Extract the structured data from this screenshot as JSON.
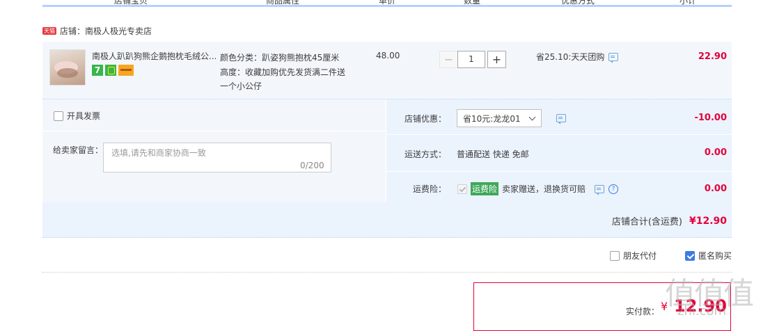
{
  "header": {
    "columns": [
      "店铺宝贝",
      "商品属性",
      "单价",
      "数量",
      "优惠方式",
      "小计"
    ]
  },
  "shop": {
    "badge": "天猫",
    "label": "店铺：南极人极光专卖店"
  },
  "item": {
    "title": "南极人趴趴狗熊企鹅抱枕毛绒公...",
    "service_icon_7": "7",
    "attr_line1": "颜色分类：趴姿狗熊抱枕45厘米",
    "attr_line2": "高度：收藏加购优先发货满二件送",
    "attr_line3": "一个小公仔",
    "price": "48.00",
    "qty_minus": "−",
    "qty_value": "1",
    "qty_plus": "+",
    "promo": "省25.10:天天团购",
    "subtotal": "22.90"
  },
  "options": {
    "invoice_label": "开具发票",
    "note_label": "给卖家留言：",
    "note_placeholder": "选填,请先和商家协商一致",
    "note_count": "0/200",
    "coupon_label": "店铺优惠：",
    "coupon_value": "省10元:龙龙01",
    "coupon_amount": "-10.00",
    "shipping_label": "运送方式：",
    "shipping_value": "普通配送 快递 免邮",
    "shipping_amount": "0.00",
    "insurance_label": "运费险：",
    "insurance_tag": "运费险",
    "insurance_text": "卖家赠送，退换货可赔",
    "insurance_amount": "0.00",
    "shop_total_label": "店铺合计(含运费)",
    "shop_total_amount": "¥12.90"
  },
  "checkout": {
    "friend_pay_label": "朋友代付",
    "anonymous_label": "匿名购买",
    "pay_label": "实付款：",
    "pay_currency": "¥",
    "pay_amount": "12.90"
  },
  "watermark": {
    "text": "值值值",
    "sub": "zhi.com"
  }
}
